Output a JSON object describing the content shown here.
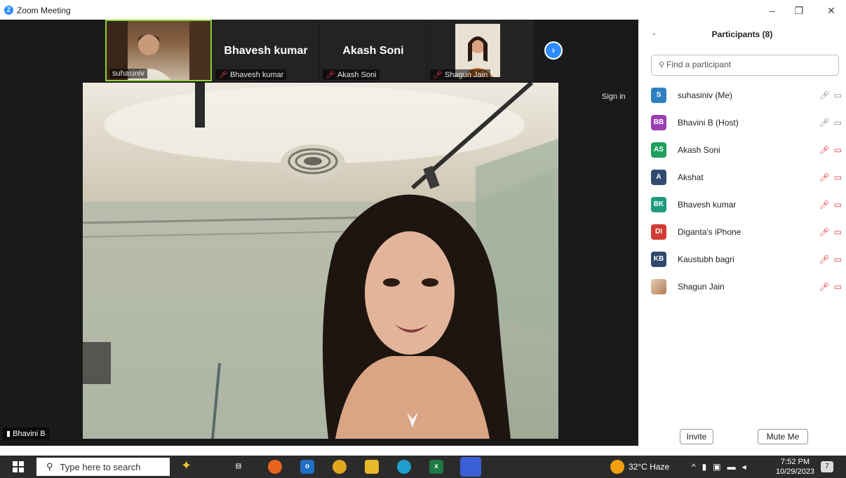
{
  "window": {
    "title": "Zoom Meeting",
    "minimize_glyph": "–",
    "restore_glyph": "❐",
    "close_glyph": "✕"
  },
  "thumbnails": [
    {
      "name": "suhasiniv",
      "big_label": "",
      "muted": false,
      "has_video": true
    },
    {
      "name": "Bhavesh kumar",
      "big_label": "Bhavesh kumar",
      "muted": true,
      "has_video": false
    },
    {
      "name": "Akash Soni",
      "big_label": "Akash Soni",
      "muted": true,
      "has_video": false
    },
    {
      "name": "Shagun Jain",
      "big_label": "",
      "muted": true,
      "has_video": true
    }
  ],
  "main": {
    "sign_in": "Sign in",
    "active_speaker": "Bhavini B"
  },
  "panel": {
    "title": "Participants (8)",
    "search_placeholder": "Find a participant",
    "invite_label": "Invite",
    "mute_me_label": "Mute Me",
    "participants": [
      {
        "initials": "S",
        "name": "suhasiniv (Me)",
        "color": "#2f7fc1",
        "muted": false
      },
      {
        "initials": "BB",
        "name": "Bhavini B (Host)",
        "color": "#9b3fb4",
        "muted": false
      },
      {
        "initials": "AS",
        "name": "Akash Soni",
        "color": "#1fa05c",
        "muted": true
      },
      {
        "initials": "A",
        "name": "Akshat",
        "color": "#2f4a6e",
        "muted": true
      },
      {
        "initials": "BK",
        "name": "Bhavesh kumar",
        "color": "#1e9b7c",
        "muted": true
      },
      {
        "initials": "DI",
        "name": "Diganta's iPhone",
        "color": "#d13b35",
        "muted": true
      },
      {
        "initials": "KB",
        "name": "Kaustubh bagri",
        "color": "#2f4a6e",
        "muted": true
      },
      {
        "initials": "",
        "name": "Shagun Jain",
        "color": "#b07a52",
        "muted": true
      }
    ]
  },
  "taskbar": {
    "search_placeholder": "Type here to search",
    "weather": "32°C Haze",
    "time": "7:52 PM",
    "date": "10/29/2023",
    "notification_count": "7"
  }
}
